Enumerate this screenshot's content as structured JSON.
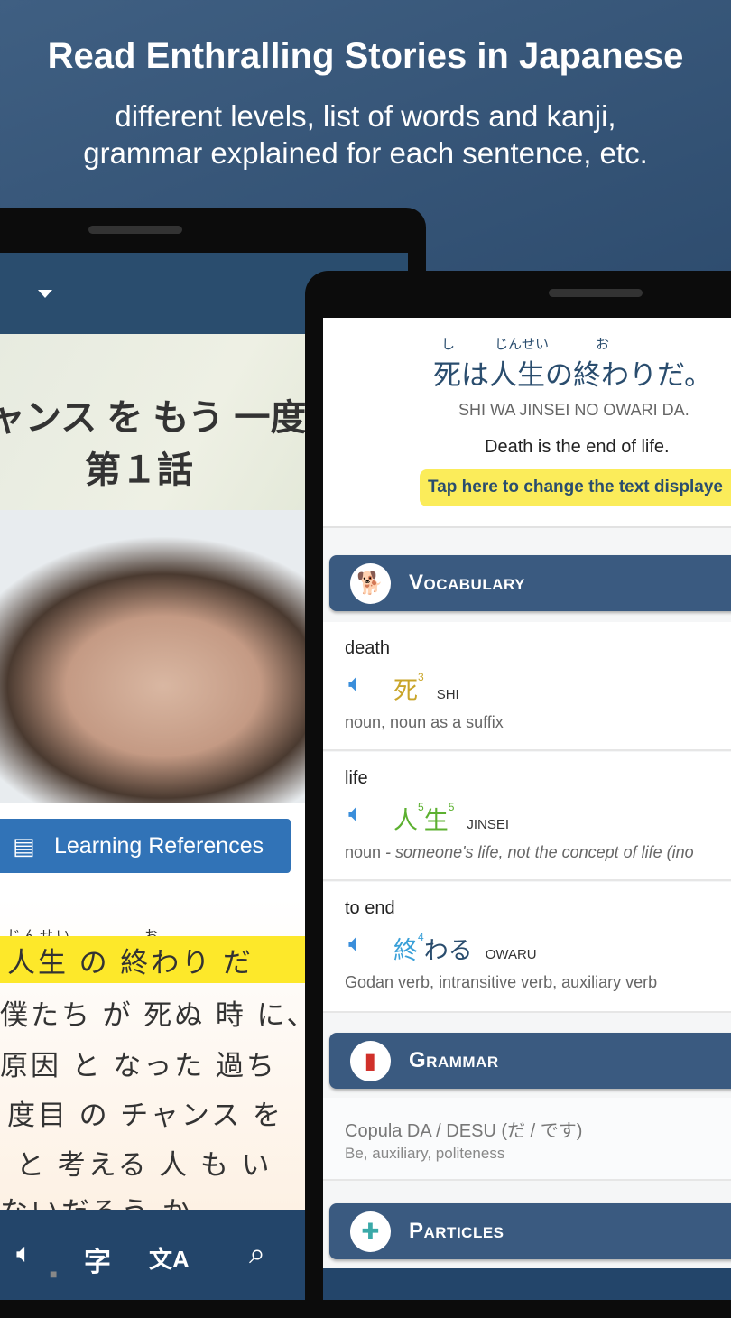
{
  "hero": {
    "title": "Read Enthralling Stories in Japanese",
    "subtitle_line1": "different levels, list of words and kanji,",
    "subtitle_line2": "grammar explained for each sentence, etc."
  },
  "left_screen": {
    "title_line1": "ャンス を もう 一度",
    "title_line2": "第１話",
    "learning_references": "Learning References",
    "furigana1": "じんせい",
    "furigana2": "お",
    "lines": [
      "人生 の 終わり だ",
      "僕たち が 死ぬ 時 に、",
      "原因 と なった 過ち",
      "度目 の チャンス を",
      "と 考える 人 も い",
      "ないだろう か"
    ],
    "toolbar": [
      "speaker-icon",
      "kanji-icon",
      "translate-icon",
      "zoom-search-icon"
    ],
    "toolbar_kanji": "字",
    "toolbar_translate": "文A"
  },
  "right_screen": {
    "furigana": [
      "し",
      "じんせい",
      "お"
    ],
    "sentence": "死は人生の終わりだ。",
    "romaji": "SHI WA JINSEI NO OWARI DA.",
    "translation": "Death is the end of life.",
    "tap_button": "Tap here to change the text displaye",
    "vocabulary": {
      "header": "Vocabulary",
      "items": [
        {
          "meaning": "death",
          "kanji": "死",
          "strokes": "3",
          "reading": "SHI",
          "desc": "noun, noun as a suffix",
          "color": "#c9a52a"
        },
        {
          "meaning": "life",
          "kanji1": "人",
          "strokes1": "5",
          "kanji2": "生",
          "strokes2": "5",
          "reading": "JINSEI",
          "pos": "noun",
          "desc": " - someone's life, not the concept of life (ino",
          "color": "#5cb030"
        },
        {
          "meaning": "to end",
          "kanji": "終",
          "strokes": "4",
          "kana": "わる",
          "reading": "OWARU",
          "desc": "Godan verb, intransitive verb, auxiliary verb",
          "color": "#3aa0d8"
        }
      ]
    },
    "grammar": {
      "header": "Grammar",
      "title": "Copula DA / DESU (だ / です)",
      "desc": "Be, auxiliary, politeness"
    },
    "particles": {
      "header": "Particles"
    }
  },
  "colors": {
    "header_blue": "#2a4d6e",
    "section_blue": "#3a5a80",
    "button_blue": "#3173b7",
    "highlight": "#fde82a"
  }
}
